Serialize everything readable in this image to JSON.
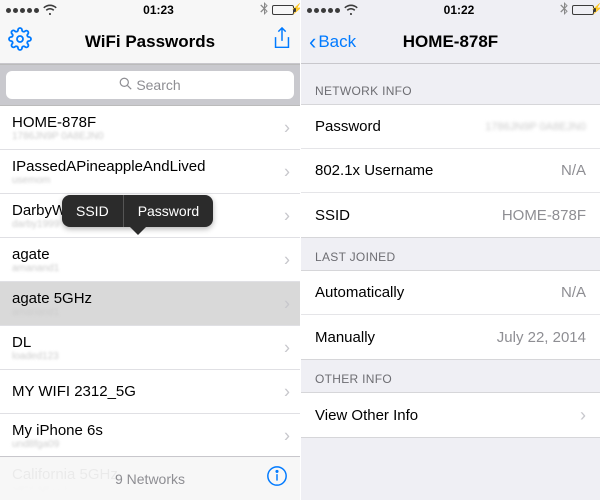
{
  "left": {
    "status": {
      "time": "01:23"
    },
    "nav": {
      "title": "WiFi Passwords"
    },
    "search": {
      "placeholder": "Search"
    },
    "popover": {
      "ssid": "SSID",
      "password": "Password"
    },
    "networks": [
      {
        "ssid": "HOME-878F",
        "sub": "1786JN9P 0A8EJN0"
      },
      {
        "ssid": "IPassedAPineappleAndLived",
        "sub": "usemom"
      },
      {
        "ssid": "DarbyWireless",
        "sub": "darby1999"
      },
      {
        "ssid": "agate",
        "sub": "amanand1"
      },
      {
        "ssid": "agate 5GHz",
        "sub": "amanand1",
        "selected": true
      },
      {
        "ssid": "DL",
        "sub": "loaded123"
      },
      {
        "ssid": "MY WIFI 2312_5G",
        "sub": ""
      },
      {
        "ssid": "My iPhone 6s",
        "sub": "und8fga09"
      },
      {
        "ssid": "California 5GHz",
        "sub": "samr0ge123"
      }
    ],
    "footer": {
      "count": "9 Networks"
    }
  },
  "right": {
    "status": {
      "time": "01:22"
    },
    "nav": {
      "back": "Back",
      "title": "HOME-878F"
    },
    "sections": {
      "network_info": {
        "header": "NETWORK INFO",
        "rows": [
          {
            "label": "Password",
            "value": "1786JN9P 0A8EJN0",
            "blur": true
          },
          {
            "label": "802.1x Username",
            "value": "N/A"
          },
          {
            "label": "SSID",
            "value": "HOME-878F"
          }
        ]
      },
      "last_joined": {
        "header": "LAST JOINED",
        "rows": [
          {
            "label": "Automatically",
            "value": "N/A"
          },
          {
            "label": "Manually",
            "value": "July 22, 2014"
          }
        ]
      },
      "other_info": {
        "header": "OTHER INFO",
        "rows": [
          {
            "label": "View Other Info",
            "chev": true
          }
        ]
      }
    }
  }
}
